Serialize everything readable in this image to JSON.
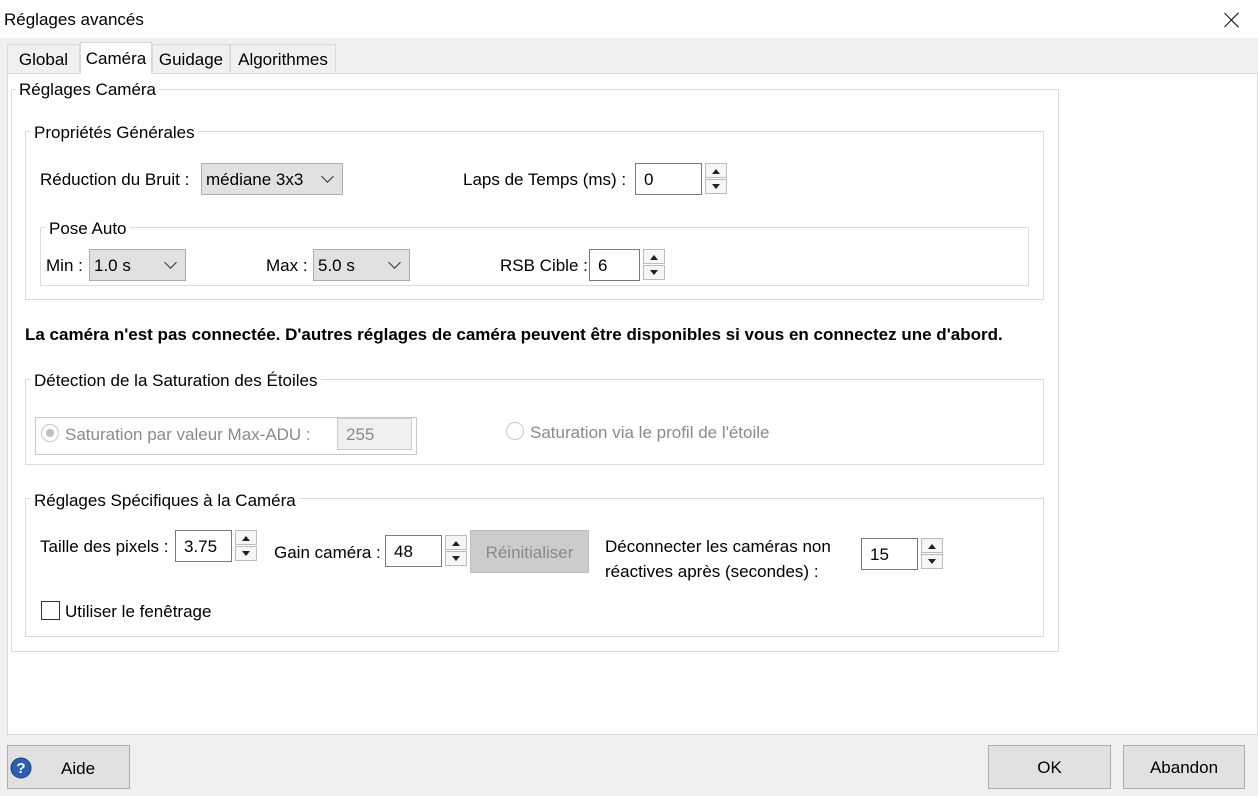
{
  "window": {
    "title": "Réglages avancés"
  },
  "tabs": [
    {
      "label": "Global",
      "active": false
    },
    {
      "label": "Caméra",
      "active": true
    },
    {
      "label": "Guidage",
      "active": false
    },
    {
      "label": "Algorithmes",
      "active": false
    }
  ],
  "camera_settings": {
    "title": "Réglages Caméra",
    "general": {
      "title": "Propriétés Générales",
      "noise_reduction": {
        "label": "Réduction du Bruit :",
        "value": "médiane 3x3"
      },
      "time_lapse": {
        "label": "Laps de Temps (ms) :",
        "value": "0"
      },
      "auto_exposure": {
        "title": "Pose Auto",
        "min": {
          "label": "Min :",
          "value": "1.0 s"
        },
        "max": {
          "label": "Max :",
          "value": "5.0 s"
        },
        "target_snr": {
          "label": "RSB Cible :",
          "value": "6"
        }
      }
    },
    "not_connected_msg": "La caméra n'est pas connectée. D'autres réglages de caméra peuvent être disponibles si vous en connectez une d'abord.",
    "saturation": {
      "title": "Détection de la Saturation des Étoiles",
      "max_adu": {
        "label": "Saturation par valeur Max-ADU :",
        "value": "255",
        "selected": true
      },
      "star_profile": {
        "label": "Saturation via le profil de l'étoile",
        "selected": false
      }
    },
    "specific": {
      "title": "Réglages Spécifiques à la Caméra",
      "pixel_size": {
        "label": "Taille des pixels :",
        "value": "3.75"
      },
      "gain": {
        "label": "Gain caméra :",
        "value": "48"
      },
      "reset_label": "Réinitialiser",
      "disconnect": {
        "label_line1": "Déconnecter les caméras non",
        "label_line2": "réactives après (secondes) :",
        "value": "15"
      },
      "windowing": {
        "label": "Utiliser le fenêtrage",
        "checked": false
      }
    }
  },
  "footer": {
    "help_label": "Aide",
    "ok_label": "OK",
    "cancel_label": "Abandon"
  },
  "colors": {
    "help_icon": "#2b5fb4"
  }
}
